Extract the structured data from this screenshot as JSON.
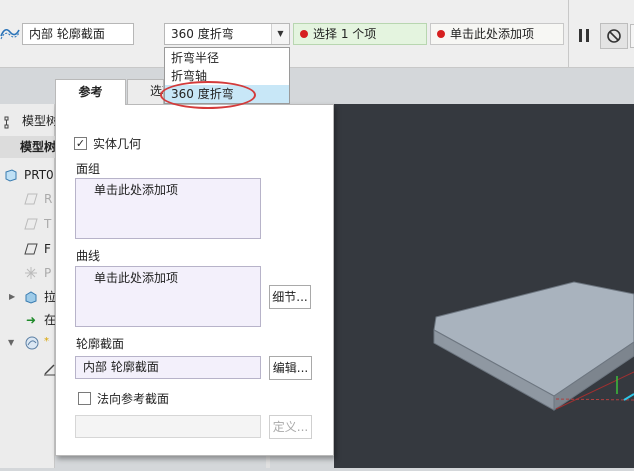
{
  "ribbon": {
    "profile_value": "内部 轮廓截面",
    "angle_value": "360 度折弯",
    "angle_options": [
      "折弯半径",
      "折弯轴",
      "360 度折弯"
    ],
    "collector_select": "选择 1 个项",
    "collector_add": "单击此处添加项"
  },
  "panel": {
    "tabs": [
      "参考",
      "选项"
    ],
    "solid_geometry_label": "实体几何",
    "solid_geometry_checked": true,
    "quilts_label": "面组",
    "quilts_placeholder": "单击此处添加项",
    "curves_label": "曲线",
    "curves_placeholder": "单击此处添加项",
    "details_button": "细节...",
    "profile_section_label": "轮廓截面",
    "profile_section_value": "内部 轮廓截面",
    "edit_button": "编辑...",
    "normal_ref_label": "法向参考截面",
    "normal_ref_checked": false,
    "define_button": "定义..."
  },
  "tree": {
    "title": "模型树",
    "header": "模型树",
    "items": [
      "PRT0",
      "R",
      "T",
      "F",
      "P",
      "拉",
      "在",
      "*"
    ]
  },
  "colors": {
    "annotation": "#d33b3b",
    "selected_option": "#c8e7f7",
    "collector_active": "#e4f4df",
    "status_dot": "#d62020",
    "viewport": "#35393f"
  }
}
